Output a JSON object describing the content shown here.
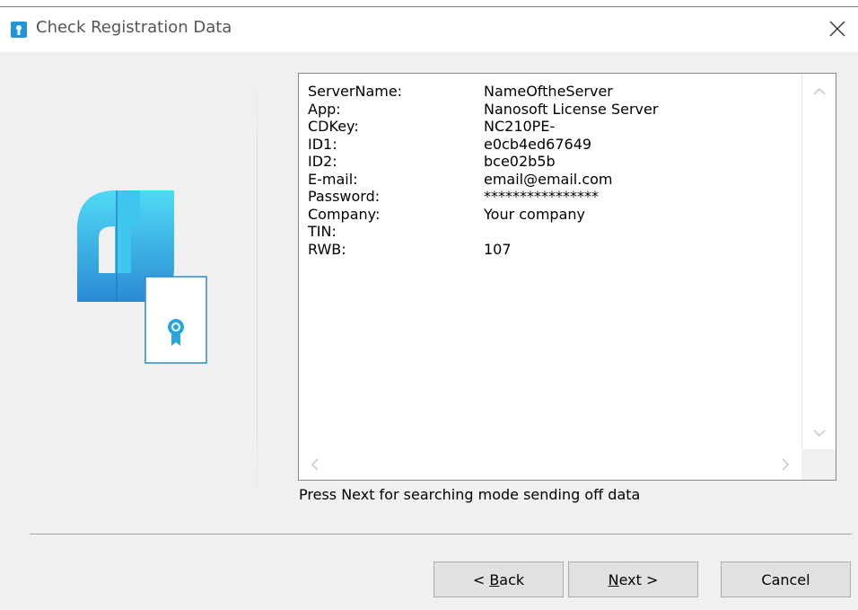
{
  "window": {
    "title": "Check Registration Data",
    "icon": "certificate-app-icon",
    "close_icon": "close-icon"
  },
  "info": {
    "rows": [
      {
        "key": "ServerName:",
        "value": "NameOftheServer"
      },
      {
        "key": "App:",
        "value": "Nanosoft License Server"
      },
      {
        "key": "CDKey:",
        "value": "NC210PE-"
      },
      {
        "key": "ID1:",
        "value": "e0cb4ed67649"
      },
      {
        "key": "ID2:",
        "value": "bce02b5b"
      },
      {
        "key": "E-mail:",
        "value": "email@email.com"
      },
      {
        "key": "Password:",
        "value": "****************"
      },
      {
        "key": "Company:",
        "value": "Your company"
      },
      {
        "key": "TIN:",
        "value": ""
      },
      {
        "key": "RWB:",
        "value": "107"
      }
    ]
  },
  "hint": "Press Next for searching mode sending off data",
  "buttons": {
    "back_prefix": "< ",
    "back_mnemonic": "B",
    "back_rest": "ack",
    "next_mnemonic": "N",
    "next_rest": "ext >",
    "cancel": "Cancel"
  },
  "colors": {
    "accent": "#2196d3",
    "logo_light": "#4dd5f3",
    "logo_dark": "#2a8fd6",
    "ribbon": "#2aa6de"
  }
}
